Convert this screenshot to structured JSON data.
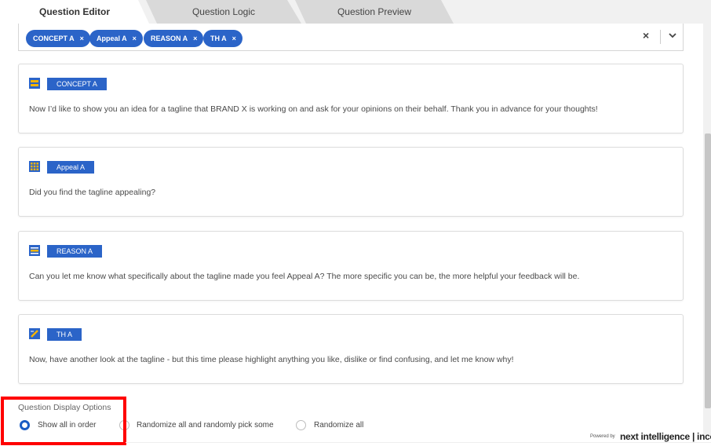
{
  "tabs": [
    {
      "label": "Question Editor",
      "active": true
    },
    {
      "label": "Question Logic",
      "active": false
    },
    {
      "label": "Question Preview",
      "active": false
    }
  ],
  "tag_select": {
    "chips": [
      "CONCEPT A",
      "Appeal A",
      "REASON A",
      "TH A"
    ],
    "remove_glyph": "×",
    "clear_glyph": "×"
  },
  "questions": [
    {
      "tag": "CONCEPT A",
      "icon": "text-block-icon",
      "text": "Now I’d like to show you an idea for a tagline that BRAND X is working on and ask for your opinions on their behalf. Thank you in advance for your thoughts!"
    },
    {
      "tag": "Appeal A",
      "icon": "grid-icon",
      "text": "Did you find the tagline appealing?"
    },
    {
      "tag": "REASON A",
      "icon": "open-text-icon",
      "text": "Can you let me know what specifically about the tagline made you feel Appeal A? The more specific you can be, the more helpful your feedback will be."
    },
    {
      "tag": "TH A",
      "icon": "highlighter-icon",
      "text": "Now, have another look at the tagline - but this time please highlight anything you like, dislike or find confusing, and let me know why!"
    }
  ],
  "display_options": {
    "title": "Question Display Options",
    "options": [
      {
        "label": "Show all in order",
        "selected": true
      },
      {
        "label": "Randomize all and randomly pick some",
        "selected": false
      },
      {
        "label": "Randomize all",
        "selected": false
      }
    ]
  },
  "footer": {
    "powered_by": "Powered by",
    "brand": "next intelligence | inco"
  },
  "colors": {
    "accent": "#2b64c8",
    "highlight": "#ff0000",
    "icon_yellow": "#f4b400"
  }
}
